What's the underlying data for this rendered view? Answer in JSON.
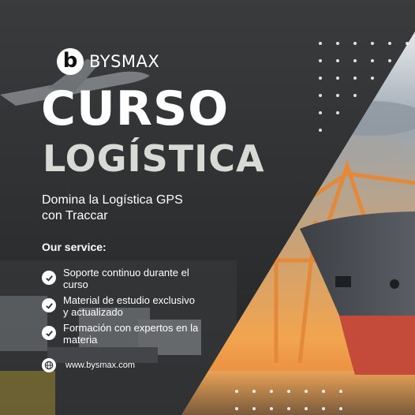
{
  "brand": {
    "logo_letter": "b",
    "name": "BYSMAX"
  },
  "headline": {
    "line1": "CURSO",
    "line2": "LOGÍSTICA"
  },
  "subtitle": {
    "line1": "Domina la Logística GPS",
    "line2": "con Traccar"
  },
  "services": {
    "heading": "Our service:",
    "items": [
      {
        "line1": "Soporte continuo durante el",
        "line2": "curso"
      },
      {
        "line1": "Material de estudio exclusivo",
        "line2": "y actualizado"
      },
      {
        "line1": "Formación con expertos en la",
        "line2": "materia"
      }
    ]
  },
  "website": "www.bysmax.com",
  "colors": {
    "background_dark": "#2b2d2f",
    "text": "#ffffff",
    "title_secondary": "#d8dad6",
    "ship_hull_red": "#c44a3a",
    "sunset": "#f0a65a"
  }
}
